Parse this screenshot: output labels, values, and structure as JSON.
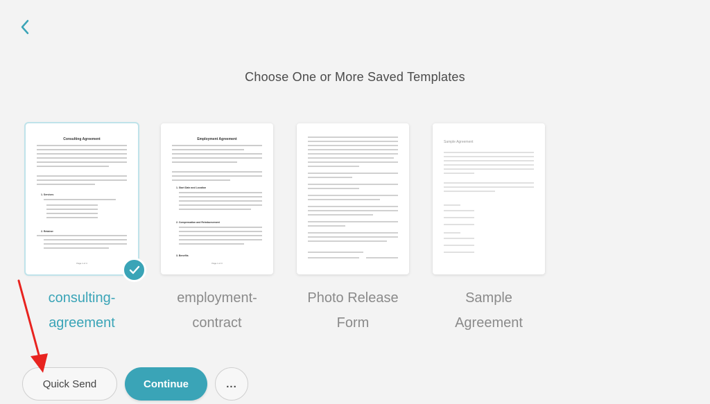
{
  "page": {
    "heading": "Choose One or More Saved Templates"
  },
  "icons": {
    "back": "chevron-left-icon",
    "selected": "checkmark-icon",
    "more": "ellipsis-icon"
  },
  "colors": {
    "accent": "#3aa4b7",
    "background": "#f3f3f3",
    "annotation_arrow": "#e8231f"
  },
  "templates": [
    {
      "label_line1": "consulting-",
      "label_line2": "agreement",
      "selected": true,
      "doc_title": "Consulting Agreement",
      "doc_headings": [
        "1. Services",
        "2. Retainer"
      ],
      "doc_footer": "Page 1 of 4"
    },
    {
      "label_line1": "employment-",
      "label_line2": "contract",
      "selected": false,
      "doc_title": "Employment Agreement",
      "doc_headings": [
        "1. Start Date and Location",
        "2. Compensation and Reimbursement",
        "3. Benefits"
      ],
      "doc_footer": "Page 1 of 3"
    },
    {
      "label_line1": "Photo Release",
      "label_line2": "Form",
      "selected": false,
      "doc_title": "",
      "doc_headings": [],
      "doc_footer": ""
    },
    {
      "label_line1": "Sample",
      "label_line2": "Agreement",
      "selected": false,
      "doc_title": "Sample Agreement",
      "doc_headings": [],
      "doc_footer": ""
    }
  ],
  "actions": {
    "quick_send": "Quick Send",
    "continue": "Continue",
    "more": "..."
  }
}
